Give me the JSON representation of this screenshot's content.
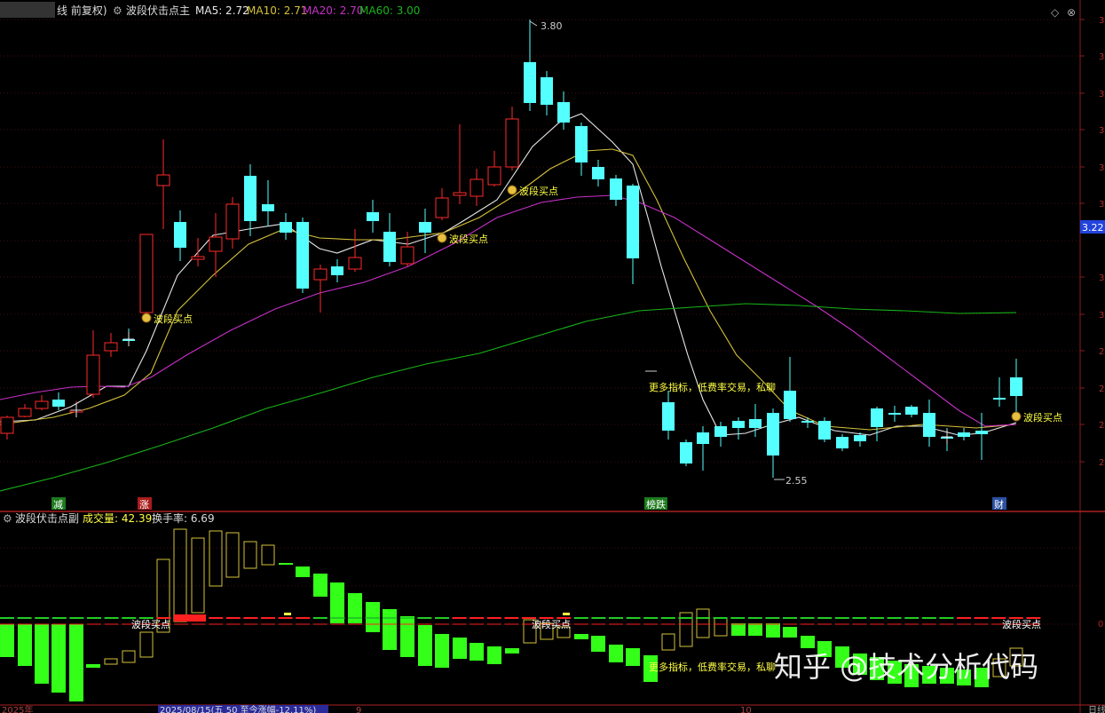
{
  "main_header": {
    "title_prefix": "线 前复权)",
    "indicator": "波段伏击点主",
    "ma5": "MA5: 2.72",
    "ma10": "MA10: 2.71",
    "ma20": "MA20: 2.70",
    "ma60": "MA60: 3.00"
  },
  "sub_header": {
    "indicator": "波段伏击点副",
    "volume": "成交量: 42.39",
    "turnover": "换手率: 6.69"
  },
  "colors": {
    "up": "#ff2a2a",
    "down": "#54ffff",
    "ma5": "#e8e8e8",
    "ma10": "#d4c23a",
    "ma20": "#c830c8",
    "ma60": "#18b418",
    "grid": "#8a1c1c",
    "signal": "#ffff44"
  },
  "price_labels": {
    "high": "3.80",
    "low": "2.55",
    "current": "3.22"
  },
  "signal_label": "波段买点",
  "promo_text": "更多指标，低费率交易，私聊",
  "bottom_tags": [
    "减",
    "涨",
    "榜跌",
    "财"
  ],
  "bottom_axis": {
    "year": "2025年",
    "selected": "2025/08/15(五 50 至今涨幅-12.11%)",
    "month9": "9",
    "month10": "10",
    "right": "日线"
  },
  "sub_axis_zero": "0",
  "watermark": "知乎 @技术分析代码",
  "right_axis_ticks": [
    "3",
    "3",
    "3",
    "3",
    "3",
    "3",
    "3",
    "3",
    "2",
    "2",
    "2",
    "2"
  ]
}
